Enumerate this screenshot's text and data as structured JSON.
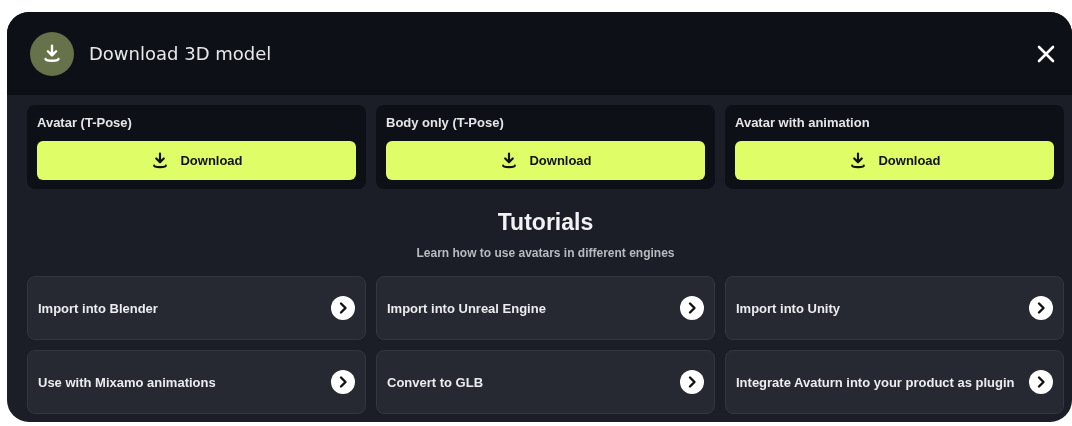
{
  "dialog": {
    "title": "Download 3D model"
  },
  "downloads": [
    {
      "label": "Avatar (T-Pose)",
      "button": "Download"
    },
    {
      "label": "Body only (T-Pose)",
      "button": "Download"
    },
    {
      "label": "Avatar with animation",
      "button": "Download"
    }
  ],
  "tutorials": {
    "title": "Tutorials",
    "subtitle": "Learn how to use avatars in different engines",
    "items": [
      {
        "label": "Import into Blender"
      },
      {
        "label": "Import into Unreal Engine"
      },
      {
        "label": "Import into Unity"
      },
      {
        "label": "Use with Mixamo animations"
      },
      {
        "label": "Convert to GLB"
      },
      {
        "label": "Integrate Avaturn into your product as plugin"
      }
    ]
  }
}
